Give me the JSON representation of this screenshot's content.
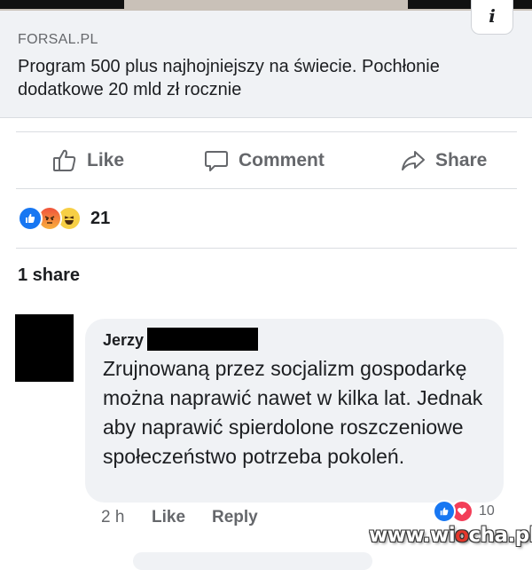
{
  "link_preview": {
    "domain": "FORSAL.PL",
    "title": "Program 500 plus najhojniejszy na świecie. Pochłonie dodatkowe 20 mld zł rocznie",
    "info_icon": "info-icon"
  },
  "actions": {
    "like_label": "Like",
    "comment_label": "Comment",
    "share_label": "Share",
    "icons": [
      "thumbs-up-icon",
      "comment-icon",
      "share-arrow-icon"
    ]
  },
  "reactions": {
    "types": [
      "like",
      "angry",
      "haha"
    ],
    "count": "21"
  },
  "shares_label": "1 share",
  "comment": {
    "author": "Jerzy",
    "text": "Zrujnowaną przez socjalizm gospodarkę można naprawić nawet w kilka lat. Jednak aby naprawić spierdolone roszczeniowe społeczeństwo potrzeba pokoleń.",
    "time": "2 h",
    "like_label": "Like",
    "reply_label": "Reply",
    "reaction_types": [
      "like",
      "love"
    ],
    "reaction_count": "10"
  },
  "watermark": {
    "prefix": "www.wi",
    "highlight": "o",
    "suffix": "cha.pl"
  },
  "colors": {
    "facebook_blue": "#1877f2",
    "secondary_text": "#65676b",
    "bubble_bg": "#f0f2f5"
  }
}
